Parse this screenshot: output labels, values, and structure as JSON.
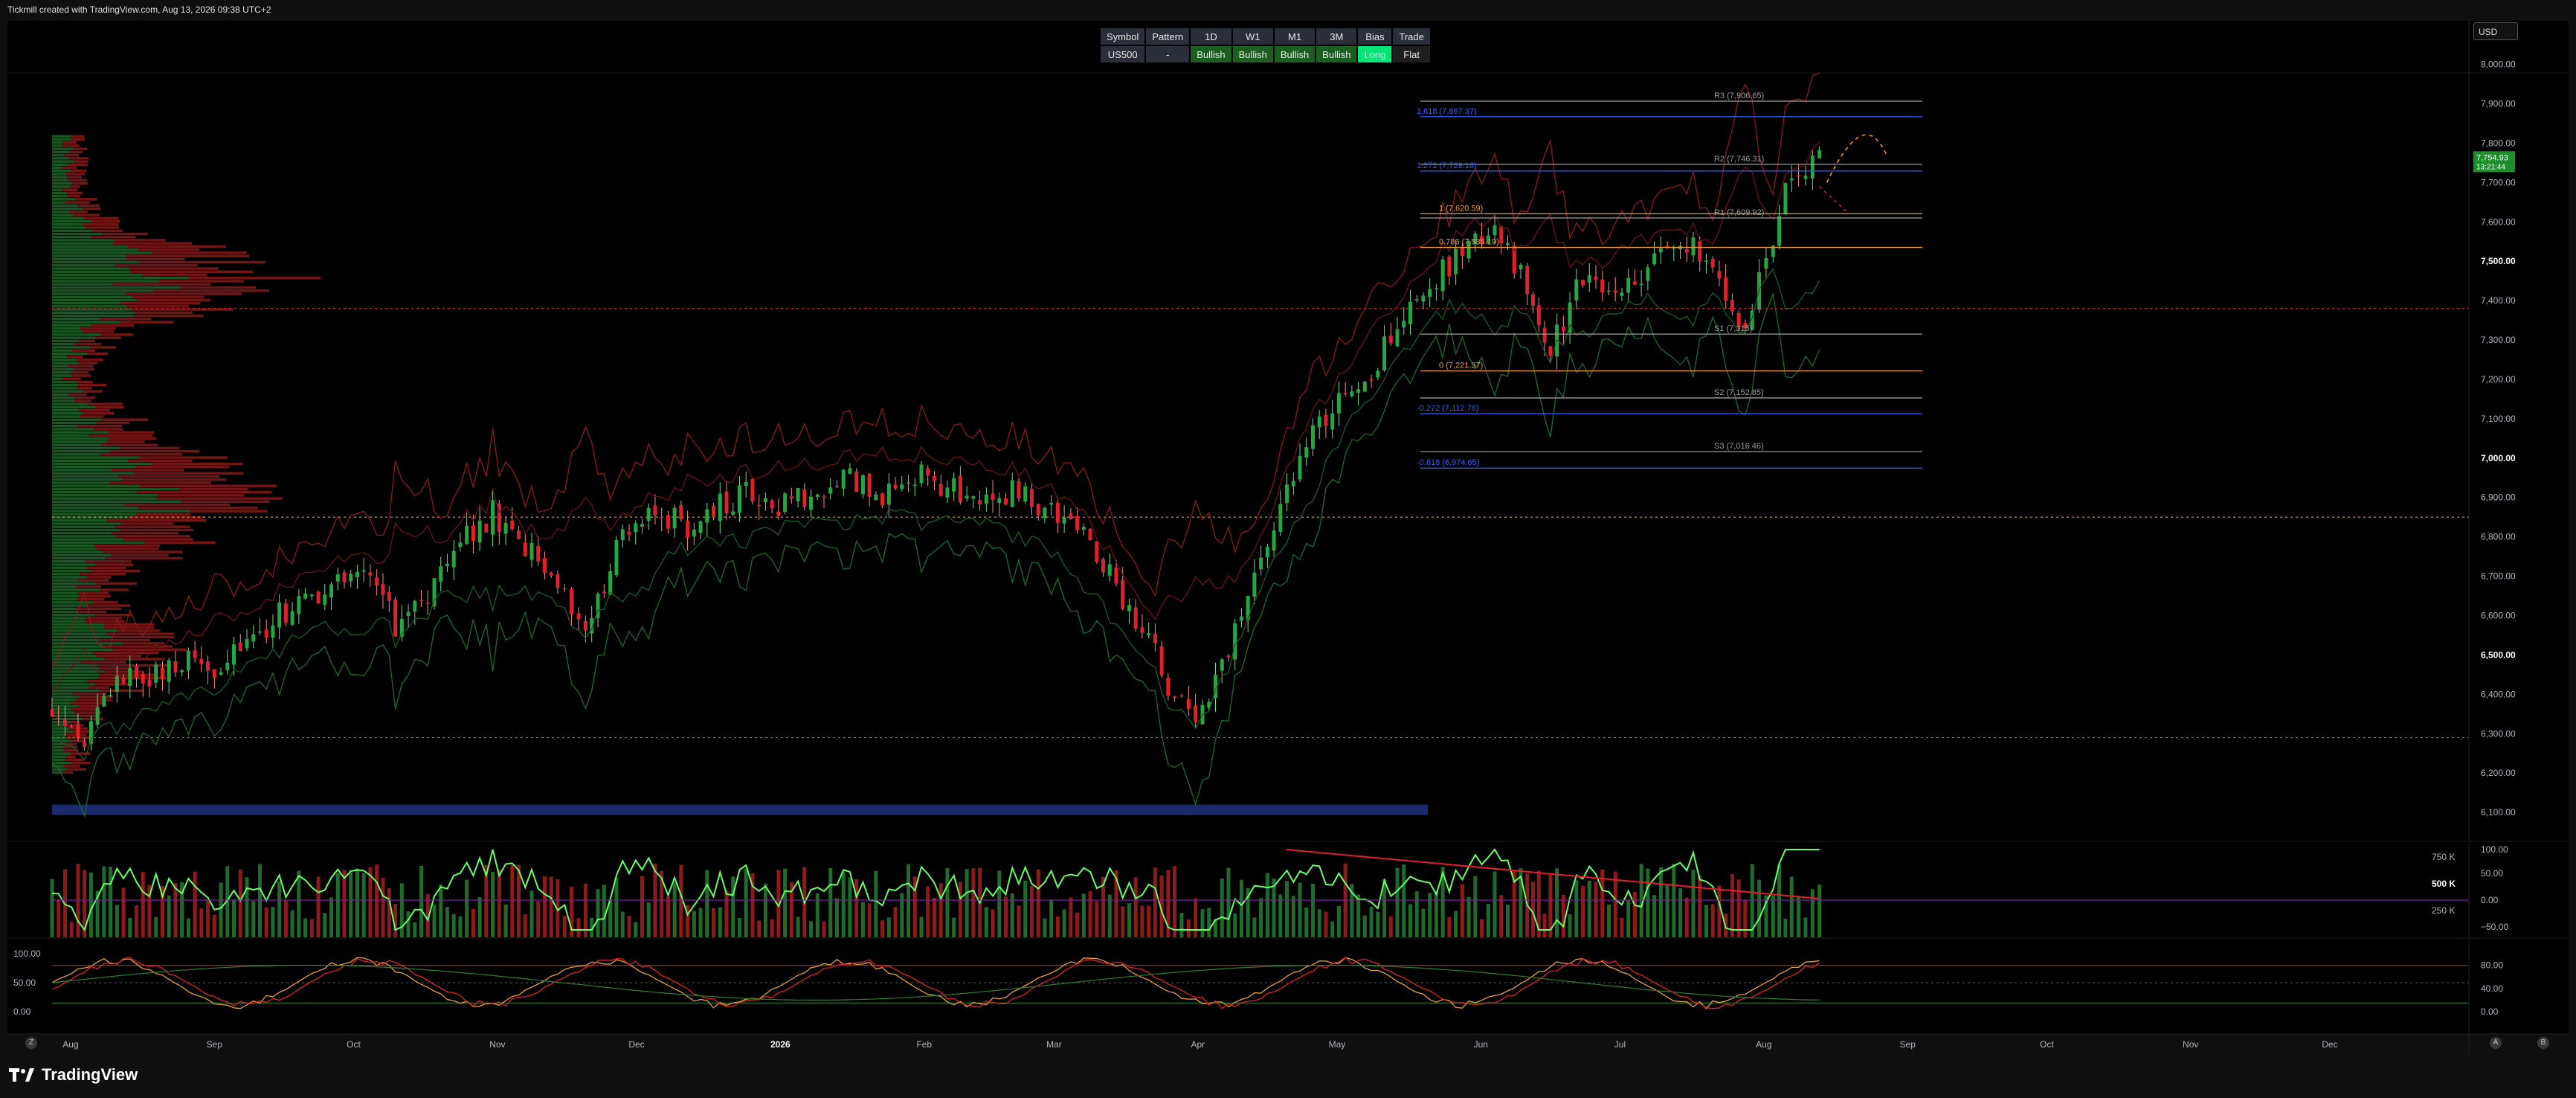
{
  "caption": "Tickmill created with TradingView.com, Aug 13, 2026 09:38 UTC+2",
  "currency": "USD",
  "brand": "TradingView",
  "info_table": {
    "headers": [
      "Symbol",
      "Pattern",
      "1D",
      "W1",
      "M1",
      "3M",
      "Bias",
      "Trade"
    ],
    "values": [
      "US500",
      "-",
      "Bullish",
      "Bullish",
      "Bullish",
      "Bullish",
      "Long",
      "Flat"
    ]
  },
  "colors": {
    "bull": "#26a641",
    "bear": "#e0202a",
    "fib": "#f0a030",
    "fib_ext": "#2962ff",
    "pivot": "#9e9e9e",
    "volume_line": "#66ff66",
    "price_tag": "#1b8f2b"
  },
  "price_tag": {
    "price": "7,754.93",
    "countdown": "13:21:44"
  },
  "bottom_buttons": [
    "Z",
    "A",
    "B"
  ],
  "chart_data": [
    {
      "type": "candlestick",
      "symbol": "US500",
      "ylim": [
        6070,
        8020
      ],
      "y_ticks": [
        "8,000.00",
        "7,900.00",
        "7,800.00",
        "7,700.00",
        "7,600.00",
        "7,500.00",
        "7,400.00",
        "7,300.00",
        "7,200.00",
        "7,100.00",
        "7,000.00",
        "6,900.00",
        "6,800.00",
        "6,700.00",
        "6,600.00",
        "6,500.00",
        "6,400.00",
        "6,300.00",
        "6,200.00",
        "6,100.00"
      ],
      "bold_ticks": [
        "7,500.00",
        "7,000.00",
        "6,500.00"
      ],
      "x_ticks": [
        "Aug",
        "Sep",
        "Oct",
        "Nov",
        "Dec",
        "2026",
        "Feb",
        "Mar",
        "Apr",
        "May",
        "Jun",
        "Jul",
        "Aug",
        "Sep",
        "Oct",
        "Nov",
        "Dec"
      ],
      "x_range": [
        "2025-07-28",
        "2026-12-31"
      ],
      "levels": [
        {
          "label": "R3 (7,906.65)",
          "value": 7906.65,
          "kind": "pivot"
        },
        {
          "label": "1.618 (7,867.37)",
          "value": 7867.37,
          "kind": "fib_ext"
        },
        {
          "label": "R2 (7,746.31)",
          "value": 7746.31,
          "kind": "pivot"
        },
        {
          "label": "1.272 (7,729.18)",
          "value": 7729.18,
          "kind": "fib_ext"
        },
        {
          "label": "1 (7,620.59)",
          "value": 7620.59,
          "kind": "fib"
        },
        {
          "label": "R1 (7,609.92)",
          "value": 7609.92,
          "kind": "pivot"
        },
        {
          "label": "0.786 (7,535.19)",
          "value": 7535.19,
          "kind": "fib"
        },
        {
          "label": "S1 (7,315)",
          "value": 7315,
          "kind": "pivot"
        },
        {
          "label": "0 (7,221.37)",
          "value": 7221.37,
          "kind": "fib"
        },
        {
          "label": "S2 (7,152.85)",
          "value": 7152.85,
          "kind": "pivot"
        },
        {
          "label": "-0.272 (7,112.78)",
          "value": 7112.78,
          "kind": "fib_ext"
        },
        {
          "label": "S3 (7,016.46)",
          "value": 7016.46,
          "kind": "pivot"
        },
        {
          "label": "-0.618 (6,974.65)",
          "value": 6974.65,
          "kind": "fib_ext"
        }
      ],
      "horizontal_lines": [
        {
          "value": 7380,
          "color": "#e0202a",
          "style": "dotted"
        },
        {
          "value": 6850,
          "color": "#f0a030",
          "style": "dotted"
        },
        {
          "value": 6290,
          "color": "#26a641",
          "style": "dotted"
        }
      ],
      "path_points": [
        {
          "date": "2025-07-28",
          "close": 6360
        },
        {
          "date": "2025-08-04",
          "close": 6300
        },
        {
          "date": "2025-08-11",
          "close": 6420
        },
        {
          "date": "2025-08-18",
          "close": 6450
        },
        {
          "date": "2025-08-25",
          "close": 6480
        },
        {
          "date": "2025-09-01",
          "close": 6460
        },
        {
          "date": "2025-09-08",
          "close": 6530
        },
        {
          "date": "2025-09-15",
          "close": 6600
        },
        {
          "date": "2025-09-22",
          "close": 6640
        },
        {
          "date": "2025-09-29",
          "close": 6690
        },
        {
          "date": "2025-10-06",
          "close": 6710
        },
        {
          "date": "2025-10-10",
          "close": 6560
        },
        {
          "date": "2025-10-17",
          "close": 6660
        },
        {
          "date": "2025-10-24",
          "close": 6780
        },
        {
          "date": "2025-10-31",
          "close": 6860
        },
        {
          "date": "2025-11-07",
          "close": 6780
        },
        {
          "date": "2025-11-14",
          "close": 6700
        },
        {
          "date": "2025-11-20",
          "close": 6560
        },
        {
          "date": "2025-11-28",
          "close": 6820
        },
        {
          "date": "2025-12-05",
          "close": 6860
        },
        {
          "date": "2025-12-12",
          "close": 6830
        },
        {
          "date": "2025-12-19",
          "close": 6880
        },
        {
          "date": "2025-12-26",
          "close": 6920
        },
        {
          "date": "2026-01-02",
          "close": 6880
        },
        {
          "date": "2026-01-09",
          "close": 6930
        },
        {
          "date": "2026-01-16",
          "close": 6950
        },
        {
          "date": "2026-01-23",
          "close": 6900
        },
        {
          "date": "2026-01-30",
          "close": 6960
        },
        {
          "date": "2026-02-06",
          "close": 6930
        },
        {
          "date": "2026-02-13",
          "close": 6870
        },
        {
          "date": "2026-02-20",
          "close": 6920
        },
        {
          "date": "2026-02-27",
          "close": 6880
        },
        {
          "date": "2026-03-06",
          "close": 6820
        },
        {
          "date": "2026-03-13",
          "close": 6700
        },
        {
          "date": "2026-03-20",
          "close": 6560
        },
        {
          "date": "2026-03-27",
          "close": 6400
        },
        {
          "date": "2026-04-02",
          "close": 6340
        },
        {
          "date": "2026-04-09",
          "close": 6560
        },
        {
          "date": "2026-04-16",
          "close": 6780
        },
        {
          "date": "2026-04-23",
          "close": 7000
        },
        {
          "date": "2026-04-30",
          "close": 7120
        },
        {
          "date": "2026-05-07",
          "close": 7200
        },
        {
          "date": "2026-05-14",
          "close": 7330
        },
        {
          "date": "2026-05-21",
          "close": 7440
        },
        {
          "date": "2026-05-28",
          "close": 7520
        },
        {
          "date": "2026-06-04",
          "close": 7600
        },
        {
          "date": "2026-06-11",
          "close": 7420
        },
        {
          "date": "2026-06-16",
          "close": 7270
        },
        {
          "date": "2026-06-23",
          "close": 7470
        },
        {
          "date": "2026-06-30",
          "close": 7390
        },
        {
          "date": "2026-07-07",
          "close": 7480
        },
        {
          "date": "2026-07-14",
          "close": 7560
        },
        {
          "date": "2026-07-21",
          "close": 7480
        },
        {
          "date": "2026-07-28",
          "close": 7340
        },
        {
          "date": "2026-08-03",
          "close": 7560
        },
        {
          "date": "2026-08-07",
          "close": 7740
        },
        {
          "date": "2026-08-13",
          "close": 7755
        }
      ]
    },
    {
      "type": "bar+line",
      "name": "volume",
      "right_ticks": [
        "100.00",
        "50.00",
        "0.00",
        "−50.00"
      ],
      "left_ticks": [
        "750 K",
        "500 K",
        "250 K"
      ],
      "bold_ticks": [
        "500 K"
      ]
    },
    {
      "type": "line",
      "name": "oscillator",
      "left_ticks": [
        "100.00",
        "50.00",
        "0.00"
      ],
      "right_ticks": [
        "80.00",
        "40.00",
        "0.00"
      ],
      "ylim": [
        0,
        100
      ]
    }
  ]
}
